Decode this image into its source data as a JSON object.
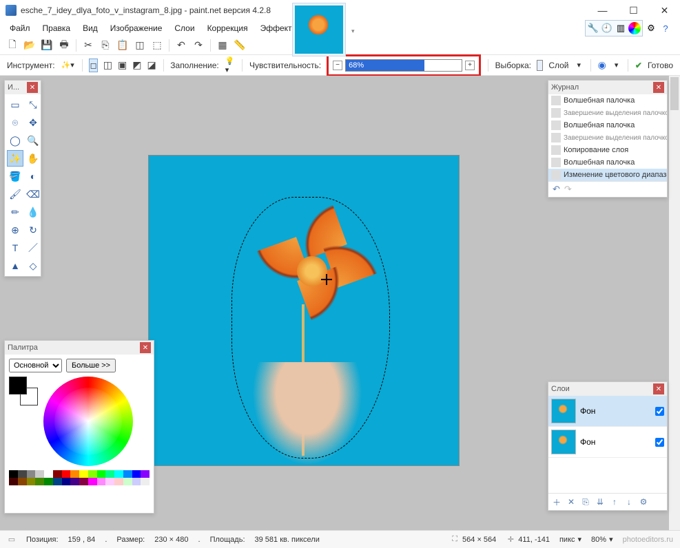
{
  "window": {
    "title": "esche_7_idey_dlya_foto_v_instagram_8.jpg - paint.net версия 4.2.8"
  },
  "menu": {
    "file": "Файл",
    "edit": "Правка",
    "view": "Вид",
    "image": "Изображение",
    "layers": "Слои",
    "adjust": "Коррекция",
    "effects": "Эффекты"
  },
  "options": {
    "tool_label": "Инструмент:",
    "fill_label": "Заполнение:",
    "tolerance_label": "Чувствительность:",
    "tolerance_value": "68%",
    "sample_label": "Выборка:",
    "sample_value": "Слой",
    "ready_label": "Готово"
  },
  "tools_panel": {
    "title": "И..."
  },
  "colors_panel": {
    "title": "Палитра",
    "mode": "Основной",
    "more": "Больше >>"
  },
  "history_panel": {
    "title": "Журнал",
    "items": [
      {
        "label": "Волшебная палочка",
        "sub": false
      },
      {
        "label": "Завершение выделения палочкой",
        "sub": true
      },
      {
        "label": "Волшебная палочка",
        "sub": false
      },
      {
        "label": "Завершение выделения палочкой",
        "sub": true
      },
      {
        "label": "Копирование слоя",
        "sub": false
      },
      {
        "label": "Волшебная палочка",
        "sub": false
      },
      {
        "label": "Изменение цветового диапазона",
        "sub": false,
        "sel": true
      }
    ]
  },
  "layers_panel": {
    "title": "Слои",
    "layers": [
      {
        "name": "Фон",
        "visible": true,
        "sel": true
      },
      {
        "name": "Фон",
        "visible": true,
        "sel": false
      }
    ]
  },
  "status": {
    "pos_label": "Позиция:",
    "pos": "159 , 84",
    "size_label": "Размер:",
    "size": "230  × 480",
    "area_label": "Площадь:",
    "area": "39 581 кв. пиксели",
    "canvas_size": "564 × 564",
    "cursor": "411, -141",
    "unit": "пикс",
    "zoom": "80%",
    "watermark": "photoeditors.ru"
  },
  "palette_colors": [
    "#000",
    "#444",
    "#888",
    "#ccc",
    "#fff",
    "#800",
    "#f00",
    "#f80",
    "#ff0",
    "#8f0",
    "#0f0",
    "#0f8",
    "#0ff",
    "#08f",
    "#00f",
    "#80f",
    "#400",
    "#840",
    "#880",
    "#480",
    "#080",
    "#048",
    "#008",
    "#408",
    "#804",
    "#f0f",
    "#f8f",
    "#fcf",
    "#fcc",
    "#cfc",
    "#ccf",
    "#eee"
  ]
}
